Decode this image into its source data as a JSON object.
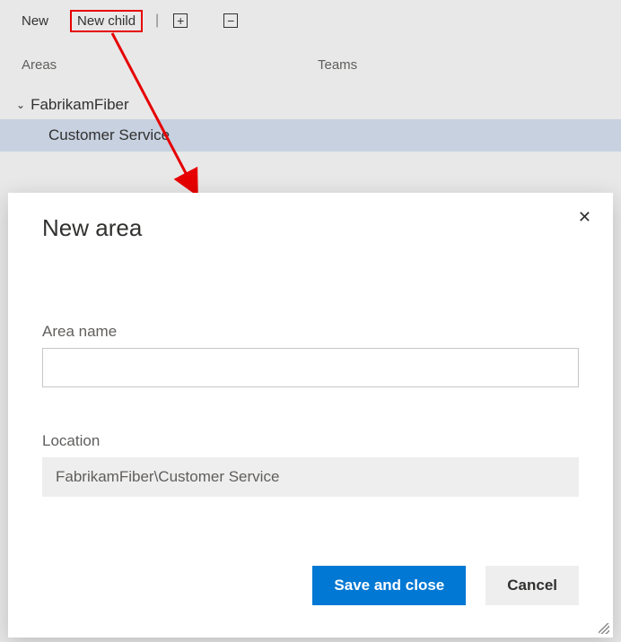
{
  "toolbar": {
    "new_label": "New",
    "new_child_label": "New child"
  },
  "tabs": {
    "areas": "Areas",
    "teams": "Teams"
  },
  "tree": {
    "root": "FabrikamFiber",
    "child": "Customer Service"
  },
  "dialog": {
    "title": "New area",
    "area_name_label": "Area name",
    "area_name_value": "",
    "location_label": "Location",
    "location_value": "FabrikamFiber\\Customer Service",
    "save_label": "Save and close",
    "cancel_label": "Cancel"
  }
}
